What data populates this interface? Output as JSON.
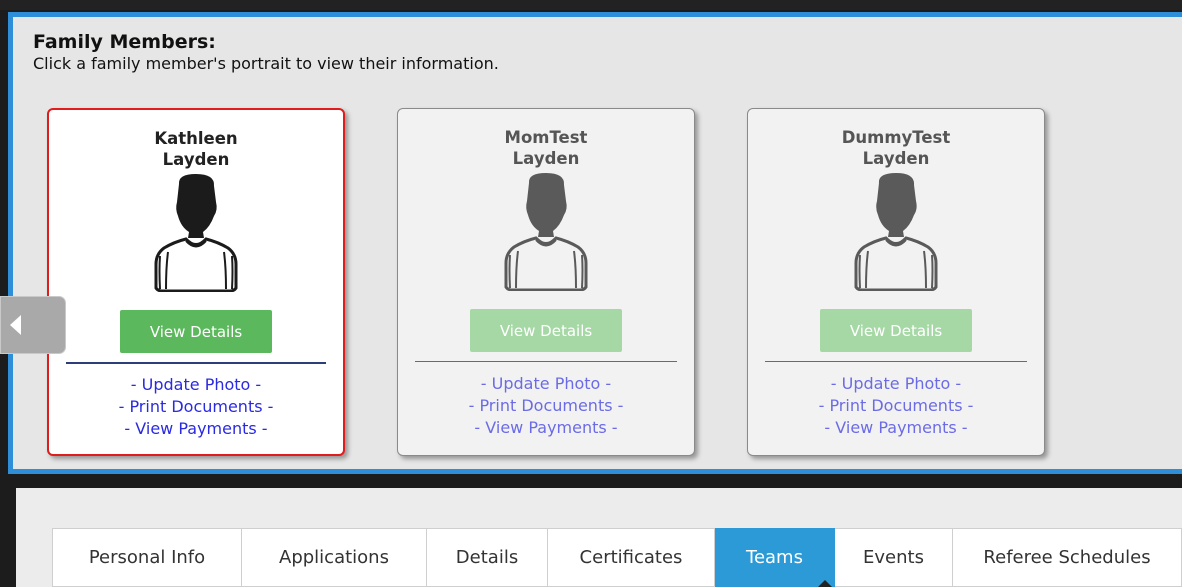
{
  "family": {
    "title": "Family Members:",
    "subtitle": "Click a family member's portrait to view their information.",
    "members": [
      {
        "first": "Kathleen",
        "last": "Layden",
        "button": "View Details",
        "link_photo": "- Update Photo -",
        "link_docs": "- Print Documents -",
        "link_pay": "- View Payments -"
      },
      {
        "first": "MomTest",
        "last": "Layden",
        "button": "View Details",
        "link_photo": "- Update Photo -",
        "link_docs": "- Print Documents -",
        "link_pay": "- View Payments -"
      },
      {
        "first": "DummyTest",
        "last": "Layden",
        "button": "View Details",
        "link_photo": "- Update Photo -",
        "link_docs": "- Print Documents -",
        "link_pay": "- View Payments -"
      }
    ],
    "selected_index": 0
  },
  "tabs": [
    {
      "label": "Personal Info",
      "active": false
    },
    {
      "label": "Applications",
      "active": false
    },
    {
      "label": "Details",
      "active": false
    },
    {
      "label": "Certificates",
      "active": false
    },
    {
      "label": "Teams",
      "active": true
    },
    {
      "label": "Events",
      "active": false
    },
    {
      "label": "Referee Schedules",
      "active": false
    }
  ],
  "colors": {
    "panel_border": "#2e8ed7",
    "selected_border": "#e01c1c",
    "button": "#5cb85c",
    "active_tab": "#2b9ad6",
    "link": "#2a2ae0"
  },
  "icons": {
    "avatar": "person-silhouette-icon",
    "scroll": "chevron-left-icon"
  }
}
